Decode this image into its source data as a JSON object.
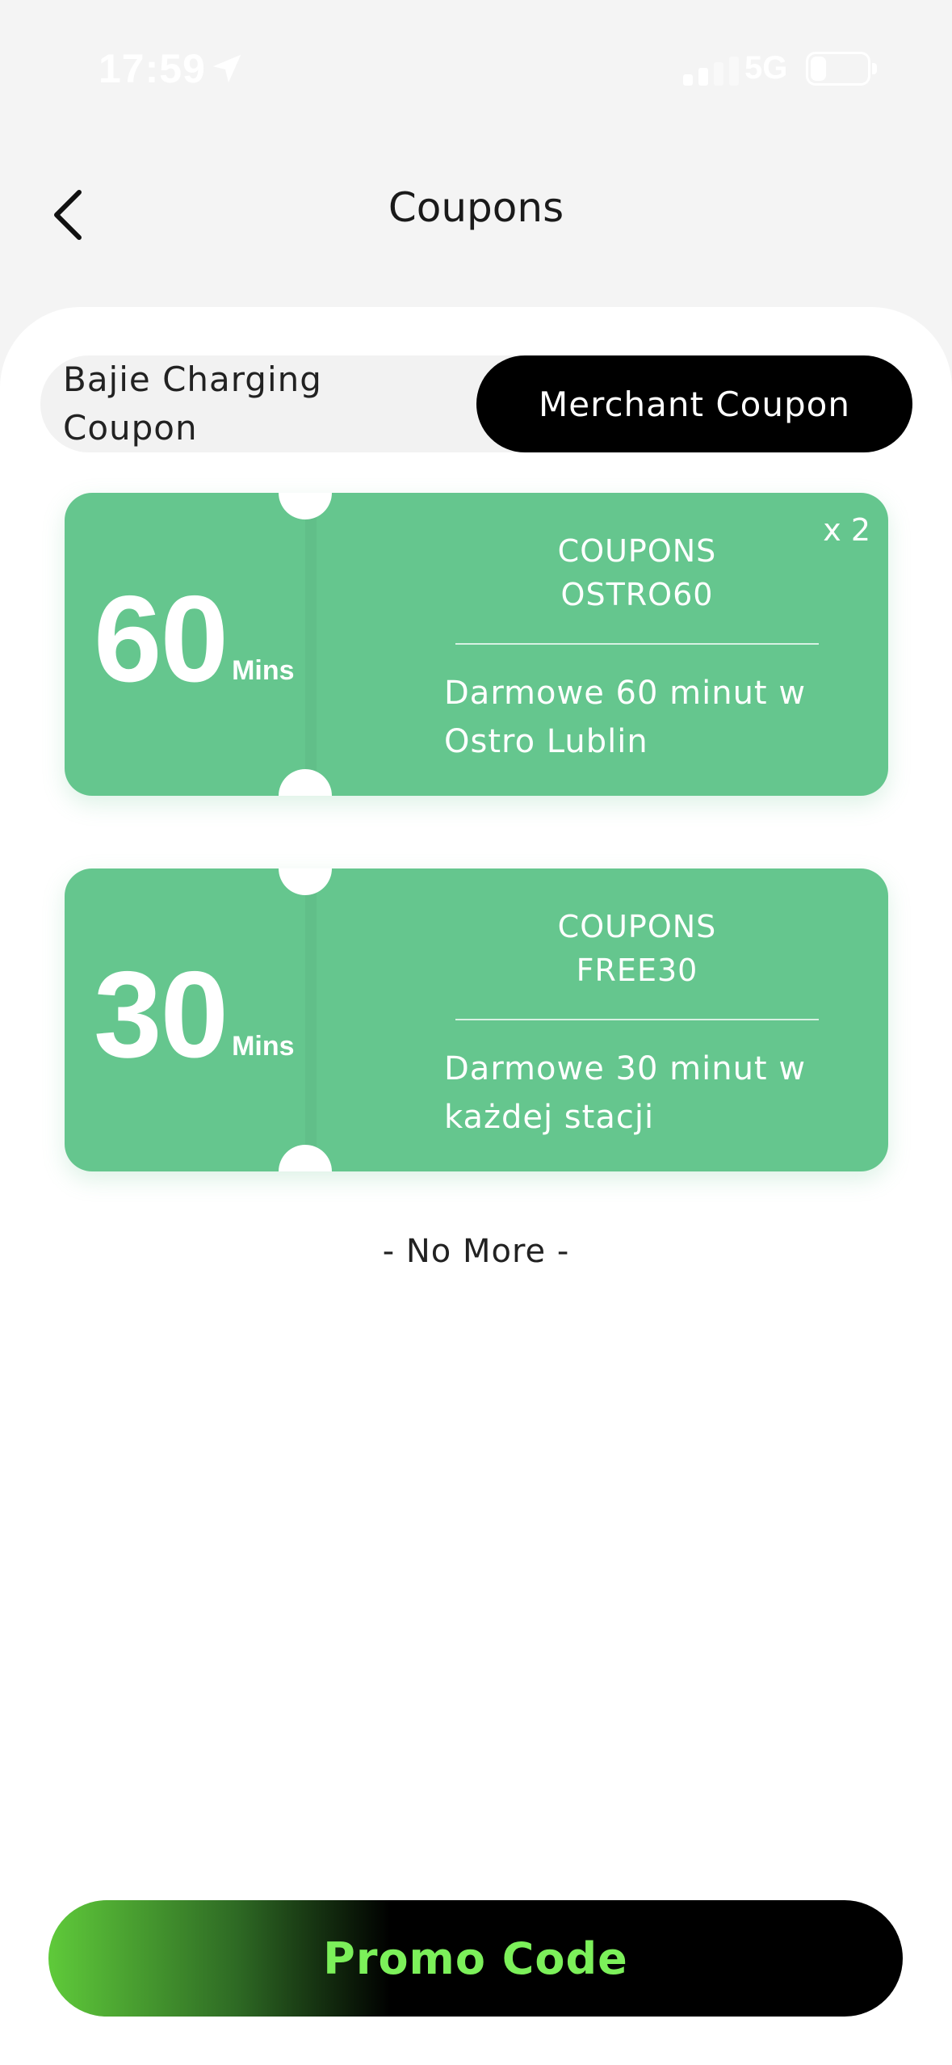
{
  "status_bar": {
    "time": "17:59",
    "network": "5G",
    "battery_level": "28",
    "battery_fraction": 0.28
  },
  "header": {
    "title": "Coupons"
  },
  "tabs": [
    {
      "label": "Bajie Charging Coupon",
      "selected": false
    },
    {
      "label": "Merchant Coupon",
      "selected": true
    }
  ],
  "coupons": [
    {
      "amount": "60",
      "unit": "Mins",
      "count": "x 2",
      "kind": "COUPONS",
      "code": "OSTRO60",
      "description": "Darmowe 60 minut w Ostro Lublin"
    },
    {
      "amount": "30",
      "unit": "Mins",
      "count": "",
      "kind": "COUPONS",
      "code": "FREE30",
      "description": "Darmowe 30 minut w każdej stacji"
    }
  ],
  "list_footer": "- No More -",
  "promo_button": {
    "label": "Promo Code"
  },
  "colors": {
    "coupon_green": "#65c68e",
    "promo_text": "#7cf05a",
    "tab_active_bg": "#000000"
  },
  "icons": {
    "back": "chevron-left-icon",
    "location": "location-arrow-icon",
    "signal": "cellular-signal-icon",
    "battery": "battery-icon"
  }
}
